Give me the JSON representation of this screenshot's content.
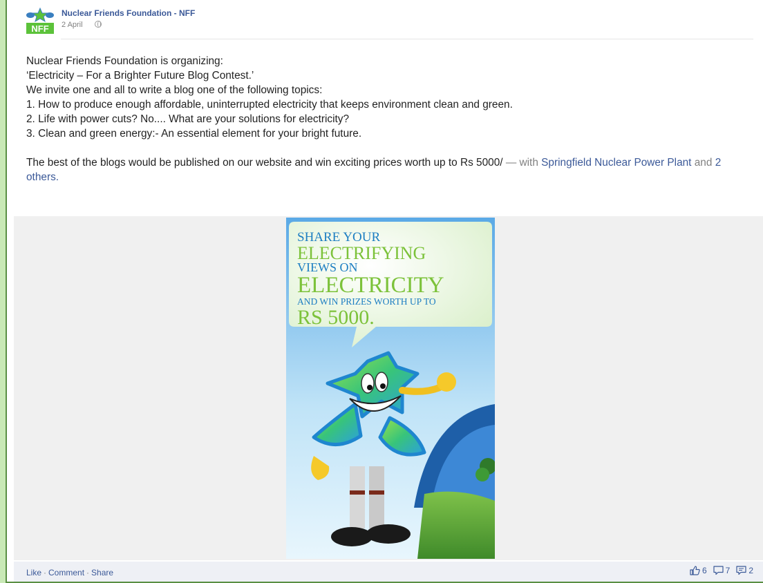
{
  "post": {
    "page_name": "Nuclear Friends Foundation - NFF",
    "date": "2 April",
    "logo_text": "NFF",
    "privacy_icon": "globe-icon",
    "lines": [
      "Nuclear Friends Foundation is organizing:",
      "‘Electricity – For a Brighter Future Blog Contest.’",
      "We invite one and all to write a blog one of the following topics:",
      "1. How to produce enough affordable, uninterrupted electricity that keeps environment clean and green.",
      "2. Life with power cuts? No.... What are your solutions for electricity?",
      "3. Clean and green energy:- An essential element for your bright future."
    ],
    "closing_text": "The best of the blogs would be published on our website and win exciting prices worth up to Rs 5000/",
    "with_text": " — with ",
    "tag_link": "Springfield Nuclear Power Plant",
    "and_text": " and ",
    "others_link": "2 others."
  },
  "poster": {
    "line1": "SHARE YOUR",
    "line2": "ELECTRIFYING",
    "line3": "VIEWS ON",
    "line4": "ELECTRICITY",
    "line5": "AND WIN PRIZES WORTH UP TO",
    "line6": "RS 5000."
  },
  "footer": {
    "like": "Like",
    "comment": "Comment",
    "share": "Share",
    "separator": "·",
    "likes_count": "6",
    "comments_count": "7",
    "shares_count": "2"
  },
  "colors": {
    "page_bg": "#c9e9b6",
    "border": "#5a8f43",
    "link": "#3b5998",
    "footer_bg": "#eef0f5",
    "media_bg": "#f0f0f0"
  }
}
